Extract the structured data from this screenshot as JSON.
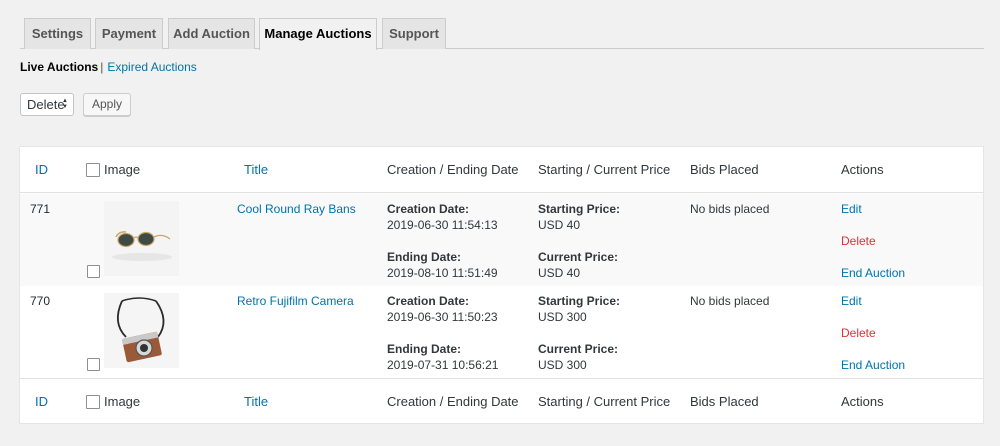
{
  "tabs": [
    "Settings",
    "Payment",
    "Add Auction",
    "Manage Auctions",
    "Support"
  ],
  "subnav": {
    "current": "Live Auctions",
    "separator": "|",
    "other": "Expired Auctions"
  },
  "bulk": {
    "selected": "Delete",
    "apply": "Apply"
  },
  "columns": {
    "id": "ID",
    "image": "Image",
    "title": "Title",
    "dates": "Creation / Ending Date",
    "price": "Starting / Current Price",
    "bids": "Bids Placed",
    "actions": "Actions"
  },
  "labels": {
    "creation": "Creation Date:",
    "ending": "Ending Date:",
    "starting": "Starting Price:",
    "current": "Current Price:"
  },
  "rows": [
    {
      "id": "771",
      "title": "Cool Round Ray Bans",
      "creation": "2019-06-30 11:54:13",
      "ending": "2019-08-10 11:51:49",
      "starting": "USD 40",
      "current": "USD 40",
      "bids": "No bids placed",
      "edit": "Edit",
      "delete": "Delete",
      "end": "End Auction"
    },
    {
      "id": "770",
      "title": "Retro Fujifilm Camera",
      "creation": "2019-06-30 11:50:23",
      "ending": "2019-07-31 10:56:21",
      "starting": "USD 300",
      "current": "USD 300",
      "bids": "No bids placed",
      "edit": "Edit",
      "delete": "Delete",
      "end": "End Auction"
    }
  ]
}
